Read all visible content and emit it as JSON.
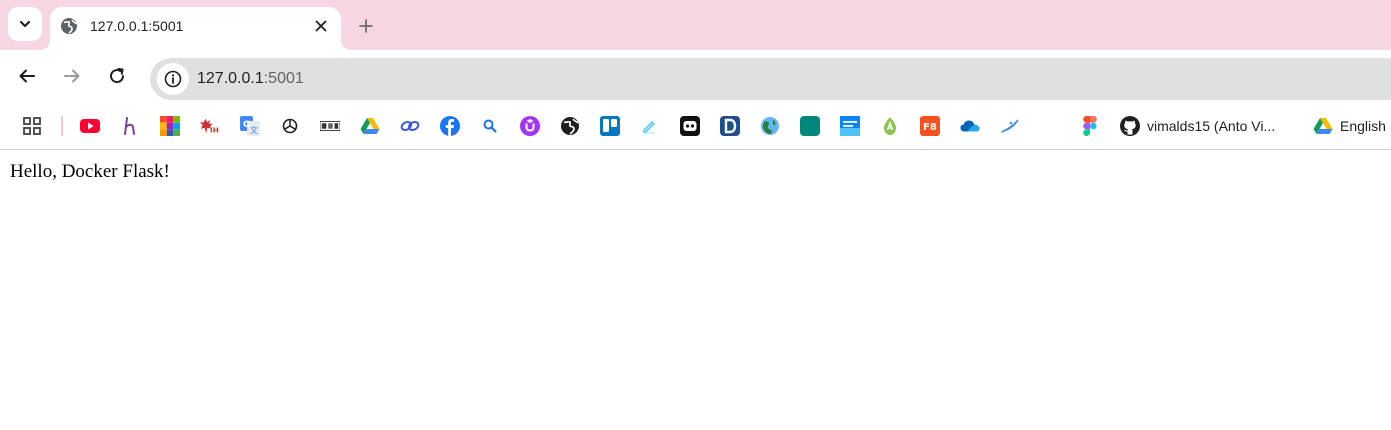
{
  "tabstrip": {
    "tab": {
      "title": "127.0.0.1:5001"
    }
  },
  "omnibox": {
    "host": "127.0.0.1",
    "port": ":5001"
  },
  "bookmarks": {
    "items": [
      {
        "icon": "youtube-icon",
        "color": "#ff0033"
      },
      {
        "icon": "hackerrank-icon",
        "color": "#7b3fa0"
      },
      {
        "icon": "microsoft-icon",
        "color": "#f25022"
      },
      {
        "icon": "interviewhelp-icon",
        "color": "#d32f2f"
      },
      {
        "icon": "google-translate-icon",
        "color": "#4285f4"
      },
      {
        "icon": "openai-icon",
        "color": "#1f1f1f"
      },
      {
        "icon": "freepik-icon",
        "color": "#333333"
      },
      {
        "icon": "google-drive-icon",
        "color": "#0f9d58"
      },
      {
        "icon": "link-icon",
        "color": "#3b5bdb"
      },
      {
        "icon": "facebook-icon",
        "color": "#1877f2"
      },
      {
        "icon": "search-icon",
        "color": "#1a73e8"
      },
      {
        "icon": "udemy-icon",
        "color": "#a435f0"
      },
      {
        "icon": "globe-icon",
        "color": "#1f1f1f"
      },
      {
        "icon": "trello-icon",
        "color": "#0079bf"
      },
      {
        "icon": "pen-icon",
        "color": "#4fc3f7"
      },
      {
        "icon": "robot-icon",
        "color": "#111111"
      },
      {
        "icon": "dev-icon",
        "color": "#1e4e8c"
      },
      {
        "icon": "earth-icon",
        "color": "#2e7d32"
      },
      {
        "icon": "teal-square-icon",
        "color": "#00897b"
      },
      {
        "icon": "textdst-icon",
        "color": "#0a84ff"
      },
      {
        "icon": "android-icon",
        "color": "#8bc34a"
      },
      {
        "icon": "f8-icon",
        "color": "#f4511e"
      },
      {
        "icon": "onedrive-icon",
        "color": "#0364b8"
      },
      {
        "icon": "swoosh-icon",
        "color": "#4a90e2"
      }
    ],
    "figma": {
      "icon": "figma-icon"
    },
    "github": {
      "icon": "github-icon",
      "label": "vimalds15 (Anto Vi..."
    },
    "drive": {
      "icon": "google-drive-icon",
      "label": "English"
    }
  },
  "page": {
    "text": "Hello, Docker Flask!"
  }
}
